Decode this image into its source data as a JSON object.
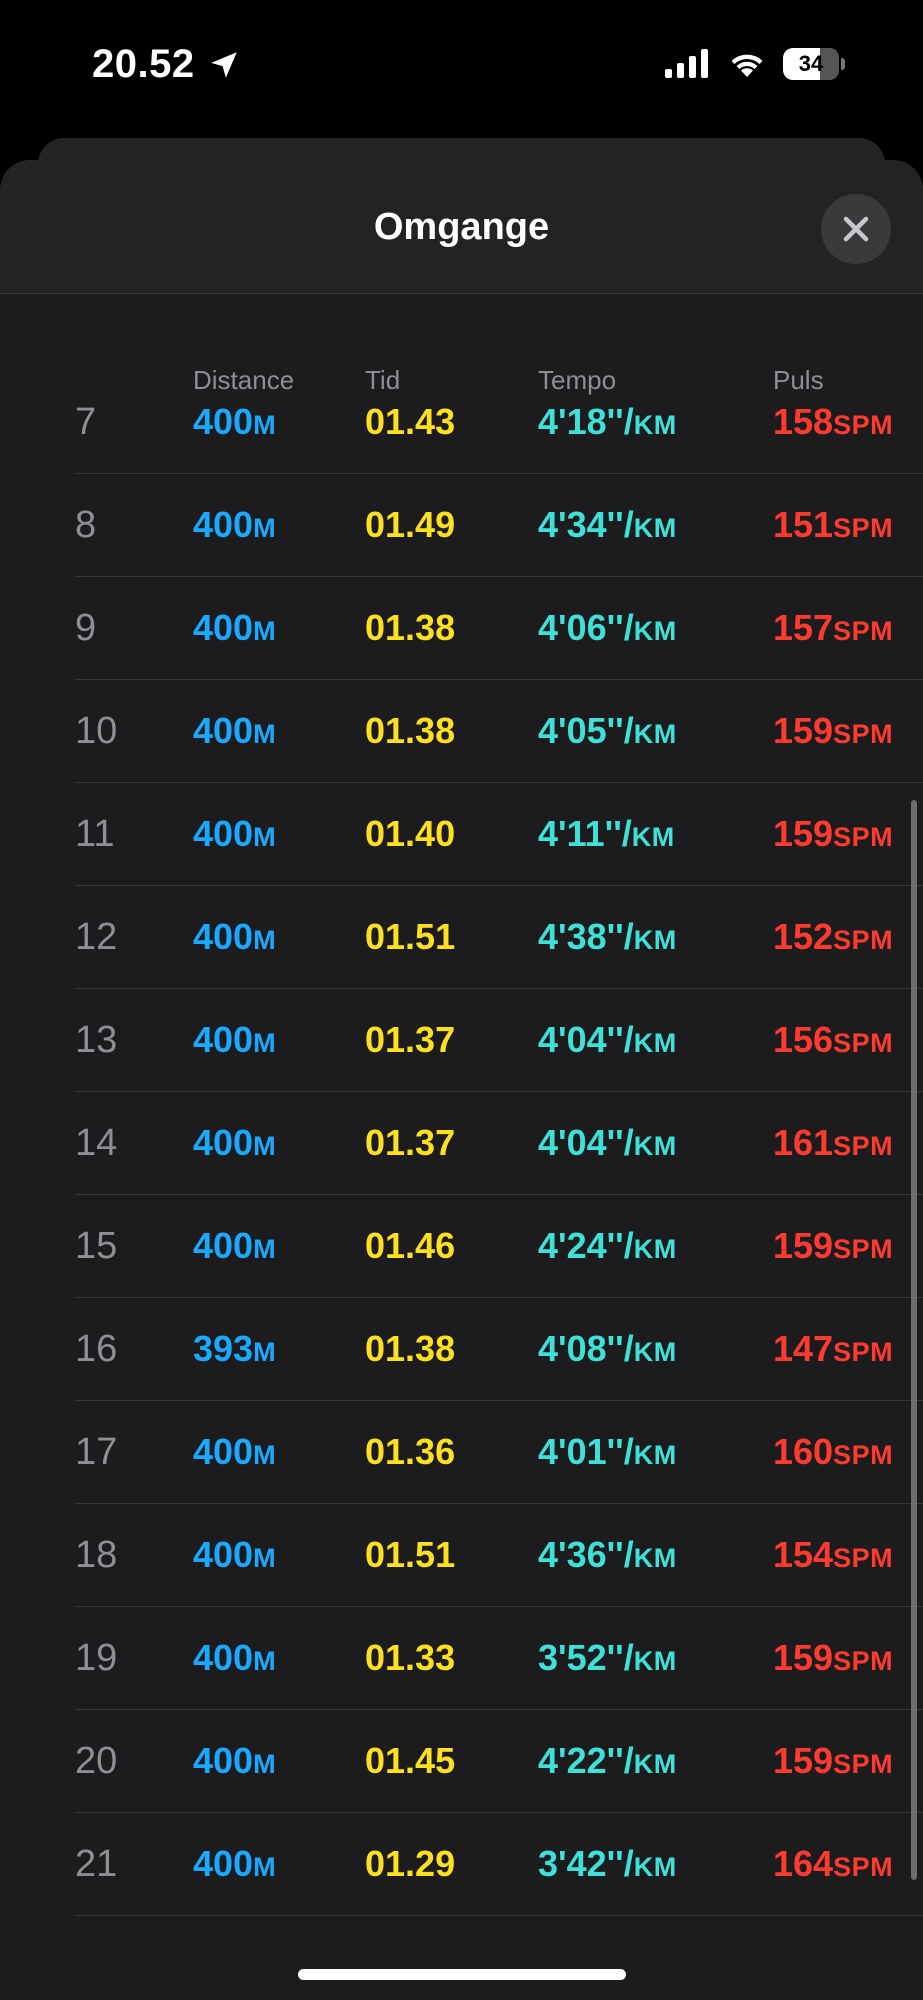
{
  "status_bar": {
    "time": "20.52",
    "battery_level": "34",
    "icons": [
      "location-arrow-icon",
      "cellular-signal-icon",
      "wifi-icon",
      "battery-icon"
    ]
  },
  "sheet": {
    "title": "Omgange",
    "close_icon": "close-icon"
  },
  "table": {
    "headers": {
      "distance": "Distance",
      "tid": "Tid",
      "tempo": "Tempo",
      "puls": "Puls"
    },
    "rows": [
      {
        "lap": "7",
        "distance": "400",
        "distance_unit": "M",
        "tid": "01.43",
        "tempo": "4'18''/",
        "tempo_unit": "KM",
        "puls": "158",
        "puls_unit": "SPM"
      },
      {
        "lap": "8",
        "distance": "400",
        "distance_unit": "M",
        "tid": "01.49",
        "tempo": "4'34''/",
        "tempo_unit": "KM",
        "puls": "151",
        "puls_unit": "SPM"
      },
      {
        "lap": "9",
        "distance": "400",
        "distance_unit": "M",
        "tid": "01.38",
        "tempo": "4'06''/",
        "tempo_unit": "KM",
        "puls": "157",
        "puls_unit": "SPM"
      },
      {
        "lap": "10",
        "distance": "400",
        "distance_unit": "M",
        "tid": "01.38",
        "tempo": "4'05''/",
        "tempo_unit": "KM",
        "puls": "159",
        "puls_unit": "SPM"
      },
      {
        "lap": "11",
        "distance": "400",
        "distance_unit": "M",
        "tid": "01.40",
        "tempo": "4'11''/",
        "tempo_unit": "KM",
        "puls": "159",
        "puls_unit": "SPM"
      },
      {
        "lap": "12",
        "distance": "400",
        "distance_unit": "M",
        "tid": "01.51",
        "tempo": "4'38''/",
        "tempo_unit": "KM",
        "puls": "152",
        "puls_unit": "SPM"
      },
      {
        "lap": "13",
        "distance": "400",
        "distance_unit": "M",
        "tid": "01.37",
        "tempo": "4'04''/",
        "tempo_unit": "KM",
        "puls": "156",
        "puls_unit": "SPM"
      },
      {
        "lap": "14",
        "distance": "400",
        "distance_unit": "M",
        "tid": "01.37",
        "tempo": "4'04''/",
        "tempo_unit": "KM",
        "puls": "161",
        "puls_unit": "SPM"
      },
      {
        "lap": "15",
        "distance": "400",
        "distance_unit": "M",
        "tid": "01.46",
        "tempo": "4'24''/",
        "tempo_unit": "KM",
        "puls": "159",
        "puls_unit": "SPM"
      },
      {
        "lap": "16",
        "distance": "393",
        "distance_unit": "M",
        "tid": "01.38",
        "tempo": "4'08''/",
        "tempo_unit": "KM",
        "puls": "147",
        "puls_unit": "SPM"
      },
      {
        "lap": "17",
        "distance": "400",
        "distance_unit": "M",
        "tid": "01.36",
        "tempo": "4'01''/",
        "tempo_unit": "KM",
        "puls": "160",
        "puls_unit": "SPM"
      },
      {
        "lap": "18",
        "distance": "400",
        "distance_unit": "M",
        "tid": "01.51",
        "tempo": "4'36''/",
        "tempo_unit": "KM",
        "puls": "154",
        "puls_unit": "SPM"
      },
      {
        "lap": "19",
        "distance": "400",
        "distance_unit": "M",
        "tid": "01.33",
        "tempo": "3'52''/",
        "tempo_unit": "KM",
        "puls": "159",
        "puls_unit": "SPM"
      },
      {
        "lap": "20",
        "distance": "400",
        "distance_unit": "M",
        "tid": "01.45",
        "tempo": "4'22''/",
        "tempo_unit": "KM",
        "puls": "159",
        "puls_unit": "SPM"
      },
      {
        "lap": "21",
        "distance": "400",
        "distance_unit": "M",
        "tid": "01.29",
        "tempo": "3'42''/",
        "tempo_unit": "KM",
        "puls": "164",
        "puls_unit": "SPM"
      }
    ]
  },
  "colors": {
    "distance": "#1aa9ff",
    "tid": "#ffe020",
    "tempo": "#3fe0d8",
    "puls": "#ff3b30",
    "lap_number": "#8e8e93",
    "sheet_background": "#1c1c1e"
  }
}
